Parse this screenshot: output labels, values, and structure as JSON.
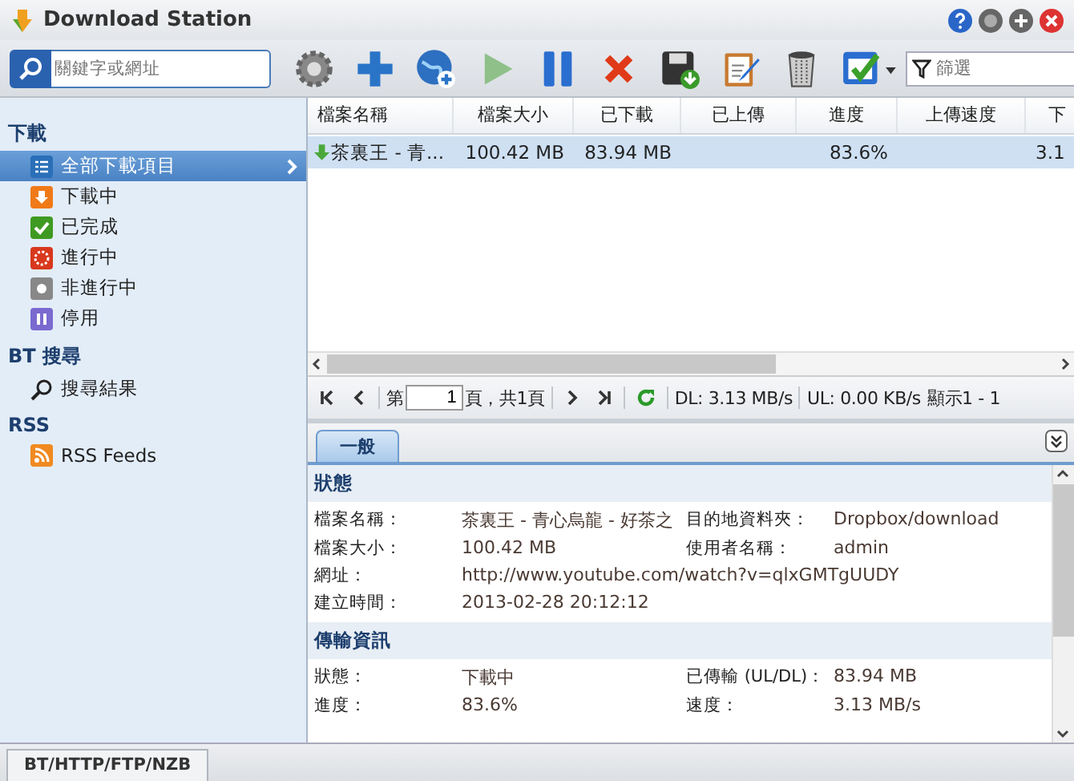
{
  "window": {
    "title": "Download Station"
  },
  "search": {
    "placeholder": "關鍵字或網址"
  },
  "filter": {
    "placeholder": "篩選"
  },
  "sidebar": {
    "sections": [
      {
        "title": "下載",
        "items": [
          {
            "label": "全部下載項目",
            "kind": "all",
            "selected": true
          },
          {
            "label": "下載中",
            "kind": "downloading",
            "selected": false
          },
          {
            "label": "已完成",
            "kind": "completed",
            "selected": false
          },
          {
            "label": "進行中",
            "kind": "active",
            "selected": false
          },
          {
            "label": "非進行中",
            "kind": "inactive",
            "selected": false
          },
          {
            "label": "停用",
            "kind": "paused",
            "selected": false
          }
        ]
      },
      {
        "title": "BT 搜尋",
        "items": [
          {
            "label": "搜尋結果",
            "kind": "search",
            "selected": false
          }
        ]
      },
      {
        "title": "RSS",
        "items": [
          {
            "label": "RSS Feeds",
            "kind": "rss",
            "selected": false
          }
        ]
      }
    ]
  },
  "table": {
    "columns": [
      "檔案名稱",
      "檔案大小",
      "已下載",
      "已上傳",
      "進度",
      "上傳速度",
      "下"
    ],
    "rows": [
      {
        "selected": true,
        "cells": [
          "茶裏王 - 青...",
          "100.42 MB",
          "83.94 MB",
          "",
          "83.6%",
          "",
          "3.1"
        ]
      }
    ]
  },
  "pager": {
    "page_prefix": "第",
    "page": "1",
    "page_suffix": "頁，共1頁",
    "dl": "DL: 3.13 MB/s",
    "ul": "UL: 0.00 KB/s",
    "display": "顯示1 - 1"
  },
  "details": {
    "tabs": [
      {
        "label": "一般",
        "selected": true
      }
    ],
    "sections": [
      {
        "title": "狀態",
        "rows": [
          [
            {
              "label": "檔案名稱：",
              "value": "茶裏王 - 青心烏龍 - 好茶之"
            },
            {
              "label": "目的地資料夾：",
              "value": "Dropbox/download"
            }
          ],
          [
            {
              "label": "檔案大小：",
              "value": "100.42 MB"
            },
            {
              "label": "使用者名稱：",
              "value": "admin"
            }
          ],
          [
            {
              "label": "網址：",
              "value": "http://www.youtube.com/watch?v=qlxGMTgUUDY"
            }
          ],
          [
            {
              "label": "建立時間：",
              "value": "2013-02-28 20:12:12"
            }
          ]
        ]
      },
      {
        "title": "傳輸資訊",
        "rows": [
          [
            {
              "label": "狀態：",
              "value": "下載中"
            },
            {
              "label": "已傳輸 (UL/DL)：",
              "value": "83.94 MB"
            }
          ],
          [
            {
              "label": "進度：",
              "value": "83.6%"
            },
            {
              "label": "速度：",
              "value": "3.13 MB/s"
            }
          ]
        ]
      }
    ]
  },
  "status_bar": {
    "tab": "BT/HTTP/FTP/NZB"
  }
}
